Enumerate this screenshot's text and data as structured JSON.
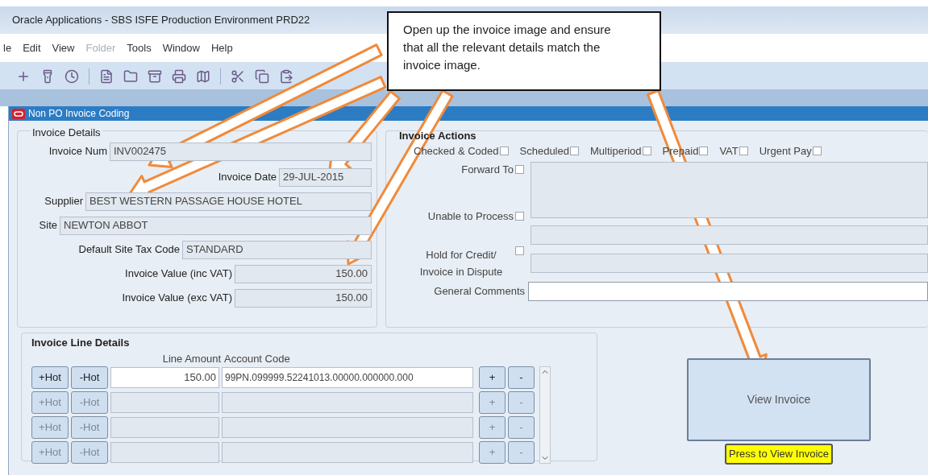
{
  "app_title": "Oracle Applications - SBS ISFE Production Environment PRD22",
  "menu": [
    {
      "label": "le",
      "disabled": false
    },
    {
      "label": "Edit",
      "disabled": false
    },
    {
      "label": "View",
      "disabled": false
    },
    {
      "label": "Folder",
      "disabled": true
    },
    {
      "label": "Tools",
      "disabled": false
    },
    {
      "label": "Window",
      "disabled": false
    },
    {
      "label": "Help",
      "disabled": false
    }
  ],
  "callout": "Open up the invoice image and ensure that all the relevant details match the invoice image.",
  "window_title": "Non PO Invoice Coding",
  "invoice_details": {
    "heading": "Invoice Details",
    "fields": [
      {
        "label": "Invoice Num",
        "value": "INV002475",
        "kind": "text"
      },
      {
        "label": "Invoice Date",
        "value": "29-JUL-2015",
        "kind": "text"
      },
      {
        "label": "Supplier",
        "value": "BEST WESTERN PASSAGE HOUSE HOTEL",
        "kind": "text"
      },
      {
        "label": "Site",
        "value": "NEWTON ABBOT",
        "kind": "text"
      },
      {
        "label": "Default Site Tax Code",
        "value": "STANDARD",
        "kind": "text"
      },
      {
        "label": "Invoice Value (inc VAT)",
        "value": "150.00",
        "kind": "number"
      },
      {
        "label": "Invoice Value (exc VAT)",
        "value": "150.00",
        "kind": "number"
      }
    ]
  },
  "invoice_actions": {
    "heading": "Invoice Actions",
    "flags": [
      {
        "label": "Checked & Coded",
        "checked": false
      },
      {
        "label": "Scheduled",
        "checked": false
      },
      {
        "label": "Multiperiod",
        "checked": false
      },
      {
        "label": "Prepaid",
        "checked": false
      },
      {
        "label": "VAT",
        "checked": false
      },
      {
        "label": "Urgent Pay",
        "checked": false
      }
    ],
    "forward_to": {
      "label": "Forward To",
      "checked": false
    },
    "unable_to_process": {
      "label": "Unable to Process",
      "checked": false
    },
    "hold": {
      "label": "Hold for Credit/ Invoice in Dispute",
      "checked": false
    },
    "comments": {
      "label": "General Comments"
    }
  },
  "line_details": {
    "heading": "Invoice Line Details",
    "columns": [
      "Line Amount",
      "Account Code"
    ],
    "rows": [
      {
        "add_hot": "+Hot",
        "remove_hot": "-Hot",
        "amount": "150.00",
        "account_code": "99PN.099999.52241013.00000.000000.000",
        "add": "+",
        "remove": "-",
        "disabled": false
      },
      {
        "add_hot": "+Hot",
        "remove_hot": "-Hot",
        "add": "+",
        "remove": "-",
        "disabled": true
      },
      {
        "add_hot": "+Hot",
        "remove_hot": "-Hot",
        "add": "+",
        "remove": "-",
        "disabled": true
      },
      {
        "add_hot": "+Hot",
        "remove_hot": "-Hot",
        "add": "+",
        "remove": "-",
        "disabled": true
      }
    ]
  },
  "view_button": "View Invoice",
  "tooltip": "Press to View Invoice"
}
